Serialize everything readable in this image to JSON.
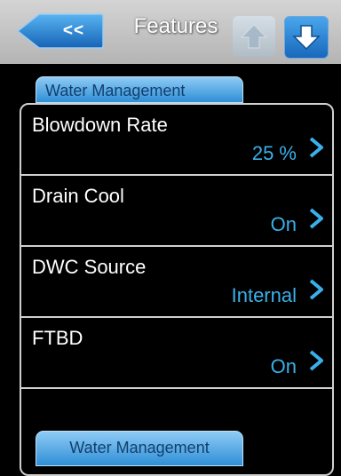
{
  "header": {
    "back_label": "<<",
    "title": "Features",
    "up_icon": "arrow-up-icon",
    "down_icon": "arrow-down-icon"
  },
  "section": {
    "tab_label": "Water Management",
    "bottom_tab_label": "Water Management"
  },
  "settings": [
    {
      "label": "Blowdown Rate",
      "value": "25 %"
    },
    {
      "label": "Drain Cool",
      "value": "On"
    },
    {
      "label": "DWC Source",
      "value": "Internal"
    },
    {
      "label": "FTBD",
      "value": "On"
    }
  ],
  "colors": {
    "accent": "#3ab0ea",
    "header_bg": "#c4c4c4",
    "tab_bg": "#5aaee6",
    "down_button": "#2a80d0"
  }
}
